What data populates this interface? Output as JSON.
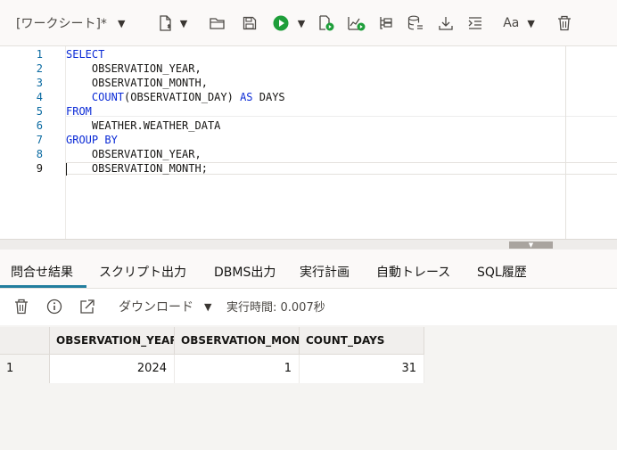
{
  "toolbar": {
    "worksheet_label": "[ワークシート]*",
    "font_button_label": "Aa"
  },
  "editor": {
    "line_numbers": [
      "1",
      "2",
      "3",
      "4",
      "5",
      "6",
      "7",
      "8",
      "9"
    ],
    "lines": [
      [
        {
          "t": "SELECT",
          "kw": true
        }
      ],
      [
        {
          "t": "    OBSERVATION_YEAR,",
          "kw": false
        }
      ],
      [
        {
          "t": "    OBSERVATION_MONTH,",
          "kw": false
        }
      ],
      [
        {
          "t": "    ",
          "kw": false
        },
        {
          "t": "COUNT",
          "kw": true
        },
        {
          "t": "(OBSERVATION_DAY) ",
          "kw": false
        },
        {
          "t": "AS",
          "kw": true
        },
        {
          "t": " DAYS",
          "kw": false
        }
      ],
      [
        {
          "t": "FROM",
          "kw": true
        }
      ],
      [
        {
          "t": "    WEATHER.WEATHER_DATA",
          "kw": false
        }
      ],
      [
        {
          "t": "GROUP BY",
          "kw": true
        }
      ],
      [
        {
          "t": "    OBSERVATION_YEAR,",
          "kw": false
        }
      ],
      [
        {
          "t": "    OBSERVATION_MONTH;",
          "kw": false
        }
      ]
    ],
    "active_line": 9
  },
  "result_tabs": {
    "tabs": [
      "問合せ結果",
      "スクリプト出力",
      "DBMS出力",
      "実行計画",
      "自動トレース",
      "SQL履歴"
    ],
    "active": 0
  },
  "result_toolbar": {
    "download_label": "ダウンロード",
    "exec_time": "実行時間: 0.007秒"
  },
  "grid": {
    "columns": [
      "OBSERVATION_YEAR",
      "OBSERVATION_MONTH",
      "COUNT_DAYS"
    ],
    "rows": [
      {
        "num": "1",
        "cells": [
          "2024",
          "1",
          "31"
        ]
      }
    ]
  },
  "colors": {
    "keyword": "#0b2bd6",
    "line_number": "#0a6aa1",
    "run_green": "#1e9e3a",
    "tab_accent": "#227e9e"
  }
}
